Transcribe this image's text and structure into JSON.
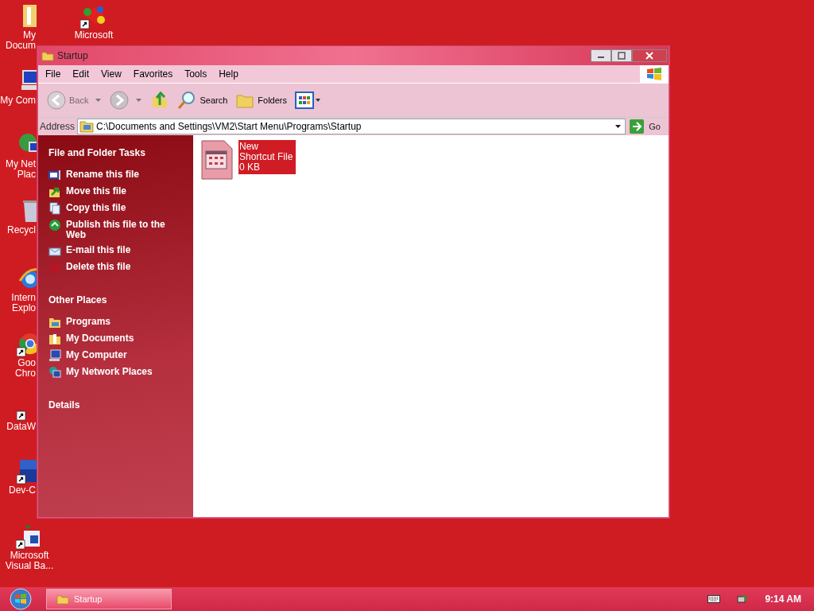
{
  "desktop_icons": [
    {
      "kind": "folder",
      "shortcut": false,
      "lines": [
        "My",
        "Docum"
      ]
    },
    {
      "kind": "app",
      "shortcut": true,
      "lines": [
        "Microsoft"
      ]
    },
    {
      "kind": "computer",
      "shortcut": false,
      "lines": [
        "My Com"
      ]
    },
    {
      "kind": "network",
      "shortcut": false,
      "lines": [
        "My Net",
        "Plac"
      ]
    },
    {
      "kind": "recycle",
      "shortcut": false,
      "lines": [
        "Recycl"
      ]
    },
    {
      "kind": "browser",
      "shortcut": false,
      "lines": [
        "Intern",
        "Explo"
      ]
    },
    {
      "kind": "chrome",
      "shortcut": true,
      "lines": [
        "Goo",
        "Chro"
      ]
    },
    {
      "kind": "blank",
      "shortcut": true,
      "lines": [
        "DataW"
      ]
    },
    {
      "kind": "dev",
      "shortcut": true,
      "lines": [
        "Dev-C"
      ]
    },
    {
      "kind": "vb",
      "shortcut": true,
      "lines": [
        "Microsoft",
        "Visual Ba..."
      ]
    }
  ],
  "window": {
    "title": "Startup",
    "menu": [
      "File",
      "Edit",
      "View",
      "Favorites",
      "Tools",
      "Help"
    ],
    "toolbar": [
      {
        "kind": "back",
        "label": "Back",
        "disabled": true
      },
      {
        "kind": "forward",
        "disabled": false
      },
      {
        "kind": "up"
      },
      {
        "kind": "search",
        "label": "Search"
      },
      {
        "kind": "folders",
        "label": "Folders"
      },
      {
        "kind": "views"
      }
    ],
    "address": {
      "label": "Address",
      "value": "C:\\Documents and Settings\\VM2\\Start Menu\\Programs\\Startup",
      "go": "Go"
    },
    "task_panes": [
      {
        "title": "File and Folder Tasks",
        "items": [
          {
            "kind": "rename",
            "label": "Rename this file"
          },
          {
            "kind": "move",
            "label": "Move this file"
          },
          {
            "kind": "copy",
            "label": "Copy this file"
          },
          {
            "kind": "publish",
            "label": "Publish this file to the Web"
          },
          {
            "kind": "email",
            "label": "E-mail this file"
          },
          {
            "kind": "delete",
            "label": "Delete this file"
          }
        ]
      },
      {
        "title": "Other Places",
        "items": [
          {
            "kind": "programs",
            "label": "Programs"
          },
          {
            "kind": "documents",
            "label": "My Documents"
          },
          {
            "kind": "computer",
            "label": "My Computer"
          },
          {
            "kind": "network",
            "label": "My Network Places"
          }
        ]
      },
      {
        "title": "Details"
      }
    ],
    "files": [
      {
        "name": "New Shortcut File",
        "size": "0 KB",
        "selected": true
      }
    ]
  },
  "taskbar": {
    "tasks": [
      {
        "label": "Startup",
        "selected": true
      }
    ],
    "clock": "9:14 AM"
  }
}
